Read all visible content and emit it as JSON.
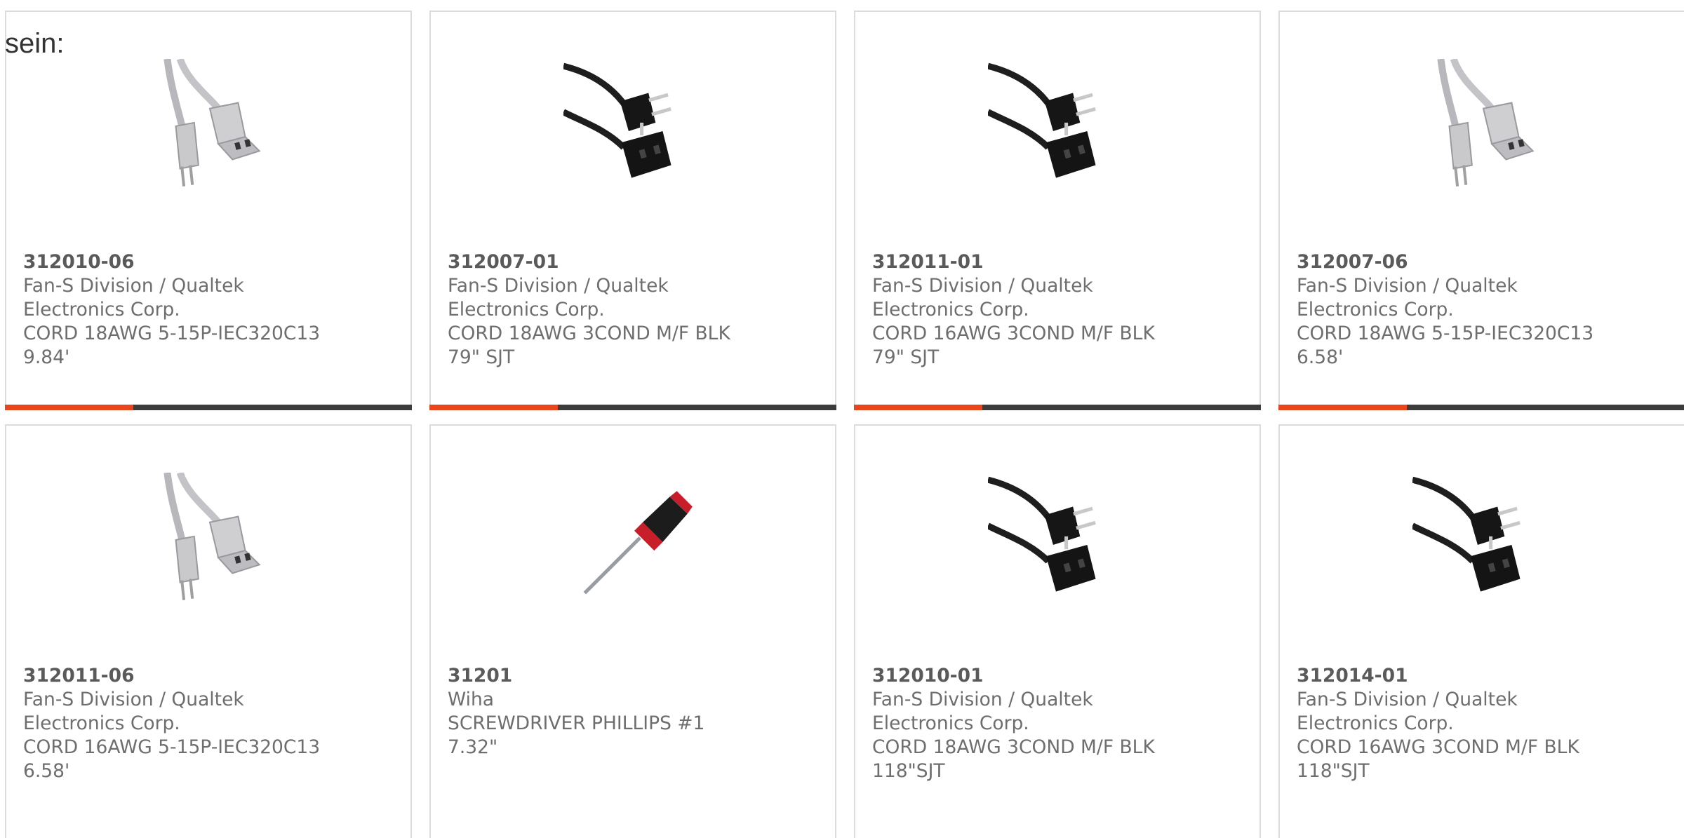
{
  "intro_text": "sein:",
  "colors": {
    "accent": "#e8461c",
    "bar_dark": "#3c3c3c",
    "text": "#6e6e6e",
    "border": "#dcdcdc"
  },
  "products": [
    {
      "part_number": "312010-06",
      "manufacturer_line1": "Fan-S Division / Qualtek",
      "manufacturer_line2": "Electronics Corp.",
      "desc_line1": "CORD 18AWG 5-15P-IEC320C13",
      "desc_line2": "9.84'",
      "image": "gray-power-cord"
    },
    {
      "part_number": "312007-01",
      "manufacturer_line1": "Fan-S Division / Qualtek",
      "manufacturer_line2": "Electronics Corp.",
      "desc_line1": "CORD 18AWG 3COND M/F BLK",
      "desc_line2": "79\" SJT",
      "image": "black-power-cord"
    },
    {
      "part_number": "312011-01",
      "manufacturer_line1": "Fan-S Division / Qualtek",
      "manufacturer_line2": "Electronics Corp.",
      "desc_line1": "CORD 16AWG 3COND M/F BLK",
      "desc_line2": "79\" SJT",
      "image": "black-power-cord"
    },
    {
      "part_number": "312007-06",
      "manufacturer_line1": "Fan-S Division / Qualtek",
      "manufacturer_line2": "Electronics Corp.",
      "desc_line1": "CORD 18AWG 5-15P-IEC320C13",
      "desc_line2": "6.58'",
      "image": "gray-power-cord"
    },
    {
      "part_number": "312011-06",
      "manufacturer_line1": "Fan-S Division / Qualtek",
      "manufacturer_line2": "Electronics Corp.",
      "desc_line1": "CORD 16AWG 5-15P-IEC320C13",
      "desc_line2": "6.58'",
      "image": "gray-power-cord"
    },
    {
      "part_number": "31201",
      "manufacturer_line1": "Wiha",
      "manufacturer_line2": "",
      "desc_line1": "SCREWDRIVER PHILLIPS #1",
      "desc_line2": "7.32\"",
      "image": "screwdriver"
    },
    {
      "part_number": "312010-01",
      "manufacturer_line1": "Fan-S Division / Qualtek",
      "manufacturer_line2": "Electronics Corp.",
      "desc_line1": "CORD 18AWG 3COND M/F BLK",
      "desc_line2": "118\"SJT",
      "image": "black-power-cord"
    },
    {
      "part_number": "312014-01",
      "manufacturer_line1": "Fan-S Division / Qualtek",
      "manufacturer_line2": "Electronics Corp.",
      "desc_line1": "CORD 16AWG 3COND M/F BLK",
      "desc_line2": "118\"SJT",
      "image": "black-power-cord"
    }
  ]
}
